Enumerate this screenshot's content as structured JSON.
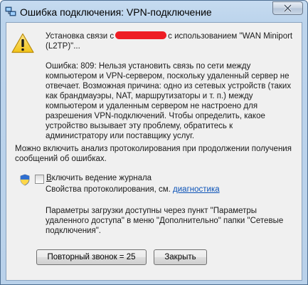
{
  "window": {
    "title": "Ошибка подключения: VPN-подключение"
  },
  "message": {
    "connect_prefix": "Установка связи с",
    "connect_suffix": "с использованием \"WAN Miniport (L2TP)\"...",
    "error_text": "Ошибка: 809: Нельзя установить связь по сети между компьютером и VPN-сервером, поскольку удаленный сервер не отвечает. Возможная причина: одно из сетевых устройств (таких как брандмауэры, NAT, маршрутизаторы и т. п.) между компьютером и удаленным сервером не настроено для разрешения VPN-подключений. Чтобы определить, какое устройство вызывает эту проблему, обратитесь к администратору или поставщику услуг.",
    "logging_hint": "Можно включить анализ протоколирования при продолжении получения сообщений об ошибках."
  },
  "logging": {
    "checkbox_label": "Включить ведение журнала",
    "checkbox_checked": false,
    "props_text": "Свойства протоколирования, см.",
    "props_link": "диагностика"
  },
  "settings_note": "Параметры загрузки доступны через пункт \"Параметры удаленного доступа\" в меню \"Дополнительно\" папки \"Сетевые подключения\".",
  "buttons": {
    "redial_label": "Повторный звонок = 25",
    "close_label": "Закрыть"
  },
  "colors": {
    "link": "#0c53b7",
    "redaction": "#ee1d24",
    "warning": "#f2c418"
  },
  "icons": {
    "title": "network-connection-icon",
    "message": "warning-icon",
    "checkbox": "uac-shield-icon",
    "close": "close-icon"
  }
}
